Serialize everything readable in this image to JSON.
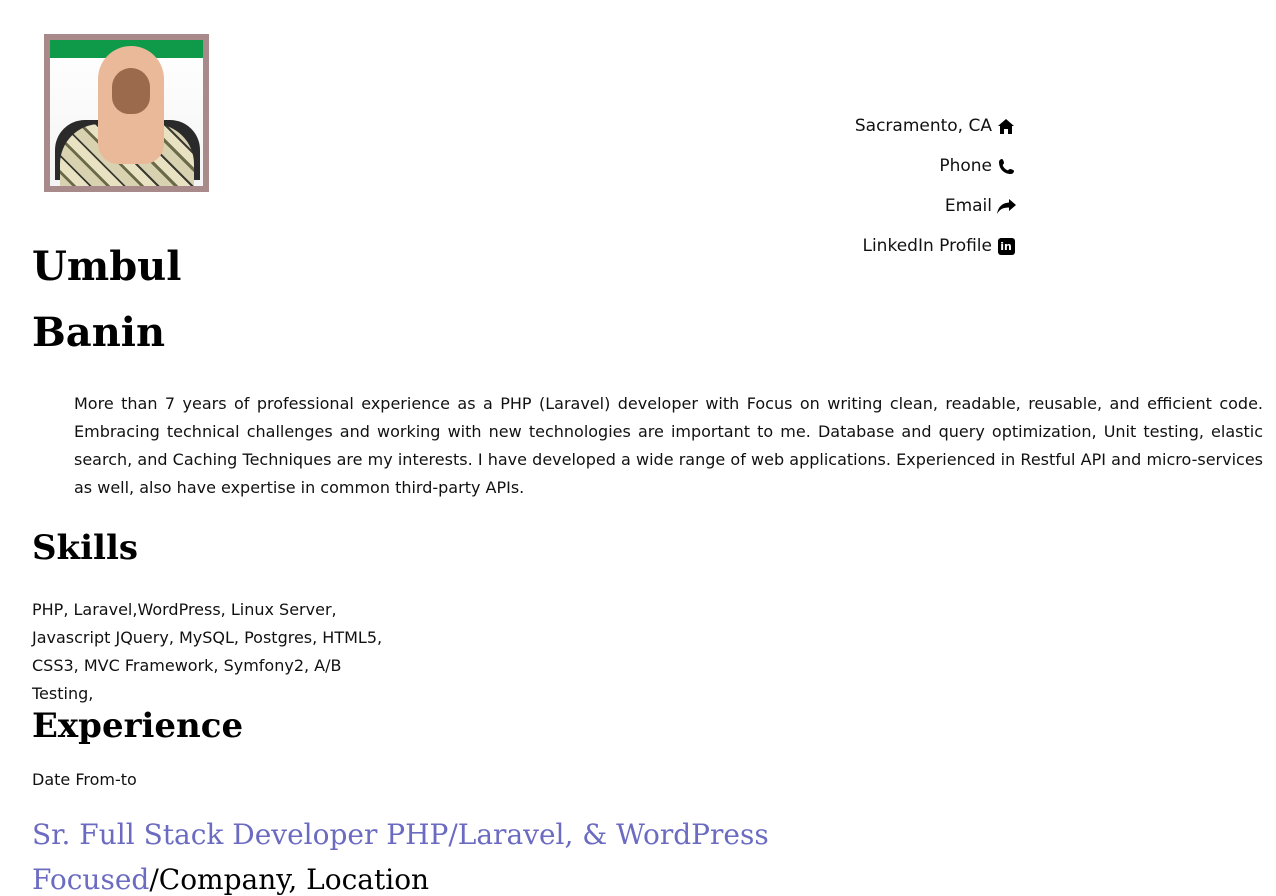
{
  "profile": {
    "first_name": "Umbul",
    "last_name": "Banin",
    "photo_alt": "profile-photo"
  },
  "contact": {
    "location": "Sacramento, CA",
    "location_icon": "home-icon",
    "phone": "Phone",
    "phone_icon": "phone-icon",
    "email": "Email",
    "email_icon": "share-arrow-icon",
    "linkedin": "LinkedIn Profile",
    "linkedin_icon": "linkedin-icon"
  },
  "summary": "More than 7 years of professional experience as a PHP (Laravel) developer with Focus on writing clean, readable, reusable, and efficient code. Embracing technical challenges and working with new technologies are important to me. Database and query optimization, Unit testing, elastic search, and Caching Techniques are my interests. I have developed a wide range of web applications. Experienced in Restful API and micro-services as well, also have expertise in common third-party APIs.",
  "skills": {
    "title": "Skills",
    "text": "PHP, Laravel,WordPress, Linux Server, Javascript JQuery, MySQL, Postgres, HTML5, CSS3, MVC Framework, Symfony2,  A/B Testing,"
  },
  "experience": {
    "title": "Experience",
    "date_range": "Date From-to",
    "job_title": "Sr. Full Stack Developer PHP/Laravel, & WordPress Focused",
    "job_meta": "/Company, Location"
  },
  "colors": {
    "accent": "#6b6bc2",
    "photo_border": "#a88a8a"
  }
}
